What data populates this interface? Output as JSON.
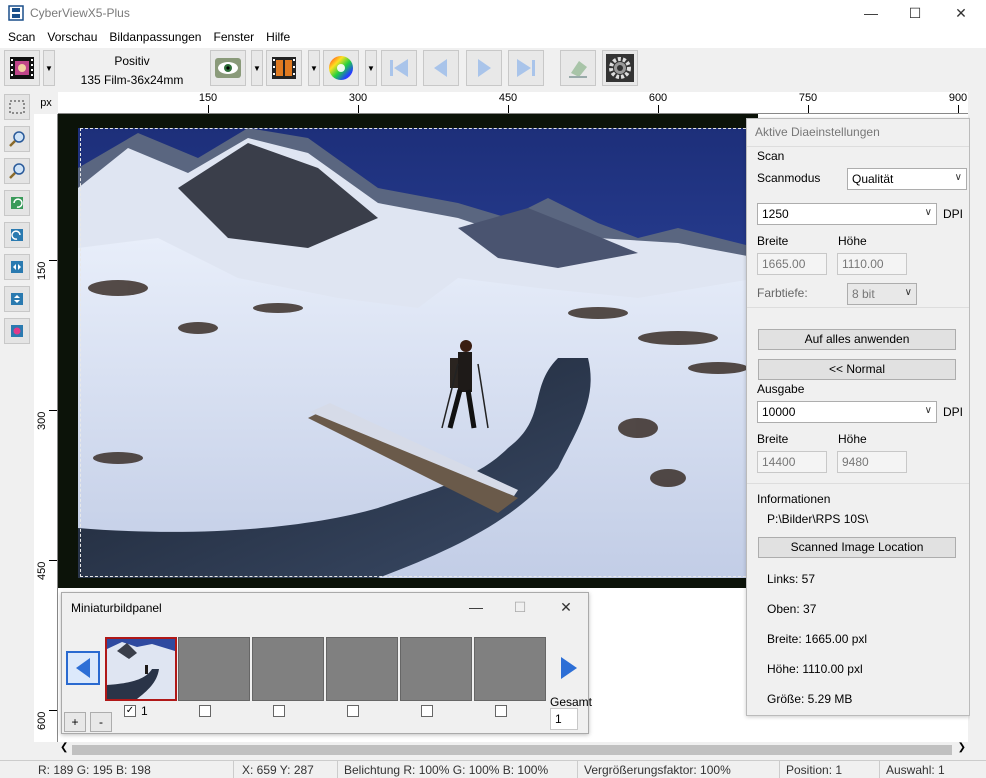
{
  "window": {
    "title": "CyberViewX5-Plus"
  },
  "menu": [
    "Scan",
    "Vorschau",
    "Bildanpassungen",
    "Fenster",
    "Hilfe"
  ],
  "toolbar": {
    "mode": "Positiv",
    "film": "135 Film-36x24mm"
  },
  "ruler": {
    "unit": "px",
    "h_labels": [
      "150",
      "300",
      "450",
      "600",
      "750",
      "900"
    ],
    "v_labels": [
      "150",
      "300",
      "450",
      "600"
    ]
  },
  "settings": {
    "title": "Aktive Diaeinstellungen",
    "scan_section": "Scan",
    "scanmodus_label": "Scanmodus",
    "scanmodus_value": "Qualität",
    "scan_dpi_value": "1250",
    "dpi_label": "DPI",
    "breite_label": "Breite",
    "hoehe_label": "Höhe",
    "scan_breite": "1665.00",
    "scan_hoehe": "1110.00",
    "farbtiefe_label": "Farbtiefe:",
    "farbtiefe_value": "8 bit",
    "apply_all": "Auf alles anwenden",
    "normal": "<< Normal",
    "ausgabe_section": "Ausgabe",
    "out_dpi_value": "10000",
    "out_breite": "14400",
    "out_hoehe": "9480",
    "info_section": "Informationen",
    "path": "P:\\Bilder\\RPS 10S\\",
    "location_button": "Scanned Image Location",
    "links": "Links: 57",
    "oben": "Oben: 37",
    "breite_info": "Breite: 1665.00 pxl",
    "hoehe_info": "Höhe: 1110.00 pxl",
    "groesse": "Größe: 5.29 MB"
  },
  "thumbpanel": {
    "title": "Miniaturbildpanel",
    "first_label": "1",
    "gesamt_label": "Gesamt",
    "gesamt_value": "1",
    "plus": "+",
    "minus": "-"
  },
  "status": {
    "rgb": "R: 189 G: 195 B: 198",
    "xy": "X: 659 Y: 287",
    "belichtung": "Belichtung R: 100% G: 100% B: 100%",
    "zoom": "Vergrößerungsfaktor: 100%",
    "position": "Position: 1",
    "auswahl": "Auswahl: 1"
  },
  "colors": {
    "accent": "#0078d7",
    "selected_thumb": "#b01818",
    "film": "#0c1309"
  }
}
